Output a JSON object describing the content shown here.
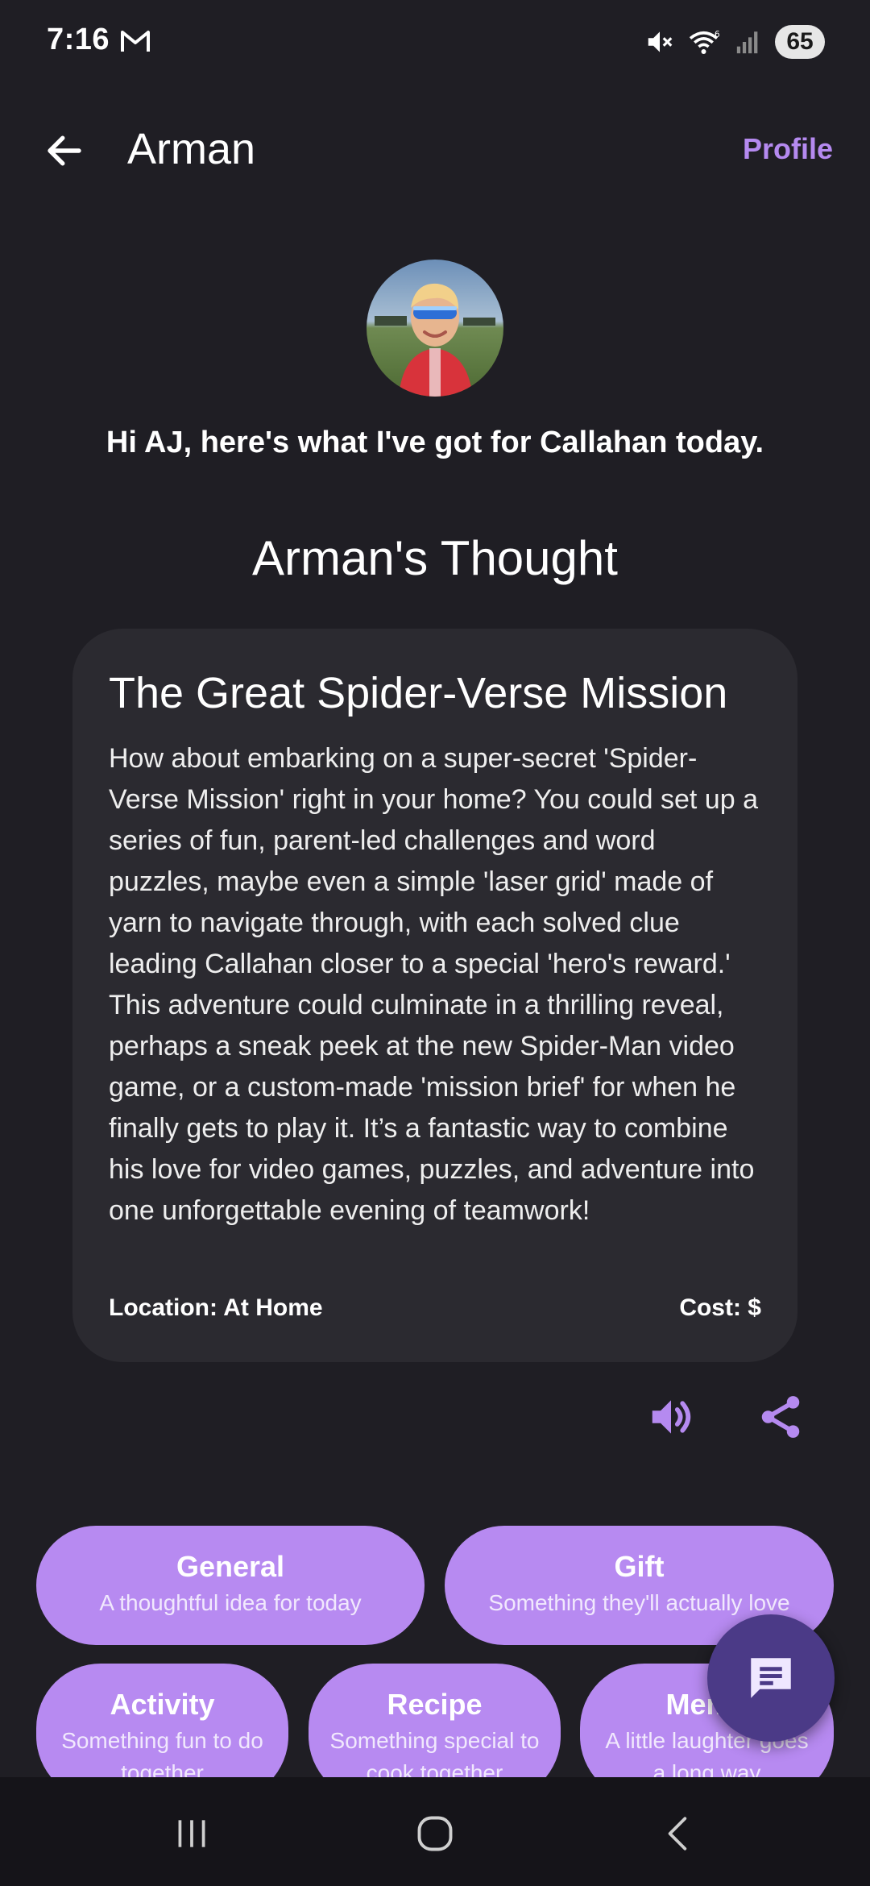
{
  "status_bar": {
    "time": "7:16",
    "battery": "65",
    "icons": [
      "gmail-icon",
      "mute-icon",
      "wifi-6-icon",
      "cellular-signal-icon",
      "battery-icon"
    ]
  },
  "app_bar": {
    "title": "Arman",
    "profile_label": "Profile",
    "back_icon": "arrow-left-icon"
  },
  "greeting": "Hi AJ, here's what I've got for Callahan today.",
  "section_title": "Arman's Thought",
  "card": {
    "title": "The Great Spider-Verse Mission",
    "body": "How about embarking on a super-secret 'Spider-Verse Mission' right in your home? You could set up a series of fun, parent-led challenges and word puzzles, maybe even a simple 'laser grid' made of yarn to navigate through, with each solved clue leading Callahan closer to a special 'hero's reward.' This adventure could culminate in a thrilling reveal, perhaps a sneak peek at the new Spider-Man video game, or a custom-made 'mission brief' for when he finally gets to play it. It’s a fantastic way to combine his love for video games, puzzles, and adventure into one unforgettable evening of teamwork!",
    "location": "Location: At Home",
    "cost": "Cost: $"
  },
  "actions": [
    "speaker-icon",
    "share-icon"
  ],
  "chips": [
    {
      "label": "General",
      "sub": "A thoughtful idea for today"
    },
    {
      "label": "Gift",
      "sub": "Something they'll actually love"
    },
    {
      "label": "Activity",
      "sub": "Something fun to do together"
    },
    {
      "label": "Recipe",
      "sub": "Something special to cook together"
    },
    {
      "label": "Meme",
      "sub": "A little laughter goes a long way"
    }
  ],
  "fab_icon": "chat-icon",
  "nav": [
    "recents-icon",
    "home-icon",
    "back-icon"
  ],
  "colors": {
    "background": "#1f1e24",
    "card": "#2b2a30",
    "accent": "#b58af0",
    "chip": "#b78af1",
    "fab": "#4b3a87"
  }
}
